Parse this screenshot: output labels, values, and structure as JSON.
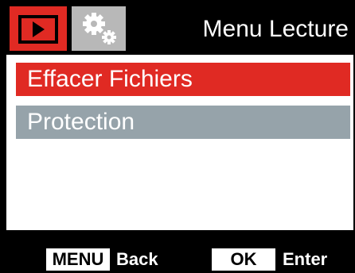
{
  "header": {
    "title": "Menu Lecture",
    "tabs": [
      {
        "icon": "play-icon",
        "active": true
      },
      {
        "icon": "gears-icon",
        "active": false
      }
    ]
  },
  "menu": {
    "items": [
      {
        "label": "Effacer Fichiers",
        "selected": true
      },
      {
        "label": "Protection",
        "selected": false
      }
    ]
  },
  "footer": {
    "menu_key": "MENU",
    "back_label": "Back",
    "ok_key": "OK",
    "enter_label": "Enter"
  },
  "colors": {
    "accent": "#e02a23",
    "item_inactive": "#96a3aa",
    "tab_inactive": "#b8b8b8",
    "background": "#000000"
  }
}
